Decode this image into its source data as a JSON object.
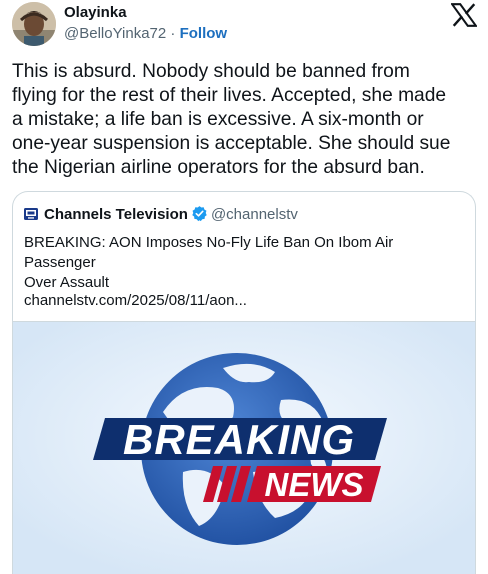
{
  "author": {
    "name": "Olayinka",
    "handle": "@BelloYinka72",
    "separator": " · ",
    "follow_label": "Follow"
  },
  "tweet": {
    "lines": [
      "This is absurd. Nobody should be banned from",
      "flying for the rest of their lives. Accepted, she made",
      "a mistake; a life ban is excessive. A six-month or",
      "one-year suspension is acceptable. She should sue",
      "the Nigerian airline operators for the absurd ban."
    ]
  },
  "quote": {
    "name": "Channels Television",
    "handle": "@channelstv",
    "text_lines": [
      "BREAKING: AON Imposes No-Fly Life Ban On Ibom Air Passenger",
      "Over Assault"
    ],
    "link": "channelstv.com/2025/08/11/aon...",
    "image": {
      "word1": "BREAKING",
      "word2": "NEWS"
    }
  },
  "icons": {
    "x_logo": "x-logo-icon",
    "verified": "verified-badge-icon",
    "channel_logo": "channels-tv-logo-icon"
  },
  "colors": {
    "link_blue": "#1d6fbf",
    "secondary_text": "#536471",
    "border": "#cfd9de",
    "news_red": "#c8102e",
    "globe_blue": "#2c64b8",
    "banner_navy": "#0e2f6e"
  }
}
